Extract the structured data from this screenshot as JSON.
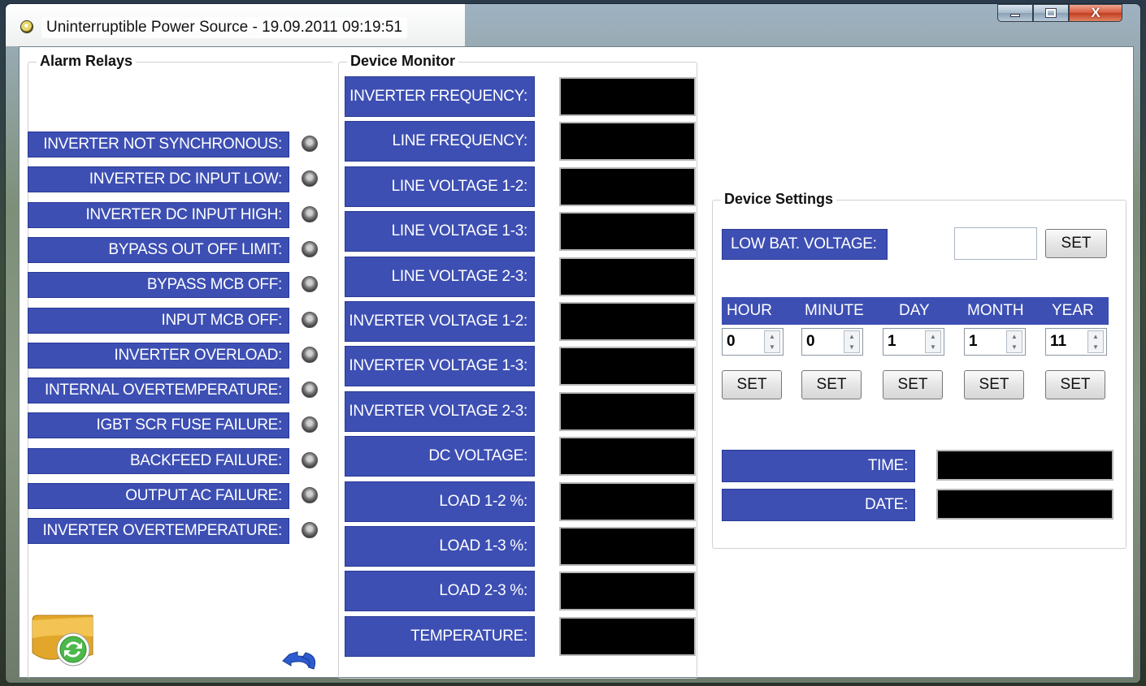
{
  "window": {
    "title": "Uninterruptible Power Source - 19.09.2011 09:19:51",
    "close_glyph": "X"
  },
  "alarm_relays": {
    "title": "Alarm Relays",
    "items": [
      "INVERTER NOT SYNCHRONOUS:",
      "INVERTER DC INPUT LOW:",
      "INVERTER DC INPUT HIGH:",
      "BYPASS OUT OFF LIMIT:",
      "BYPASS MCB OFF:",
      "INPUT MCB OFF:",
      "INVERTER OVERLOAD:",
      "INTERNAL OVERTEMPERATURE:",
      "IGBT SCR FUSE FAILURE:",
      "BACKFEED FAILURE:",
      "OUTPUT AC FAILURE:",
      "INVERTER OVERTEMPERATURE:"
    ]
  },
  "device_monitor": {
    "title": "Device Monitor",
    "items": [
      "INVERTER FREQUENCY:",
      "LINE FREQUENCY:",
      "LINE VOLTAGE 1-2:",
      "LINE VOLTAGE 1-3:",
      "LINE VOLTAGE 2-3:",
      "INVERTER VOLTAGE 1-2:",
      "INVERTER VOLTAGE 1-3:",
      "INVERTER VOLTAGE 2-3:",
      "DC VOLTAGE:",
      "LOAD 1-2 %:",
      "LOAD 1-3 %:",
      "LOAD 2-3 %:",
      "TEMPERATURE:"
    ]
  },
  "device_settings": {
    "title": "Device Settings",
    "low_bat_label": "LOW BAT. VOLTAGE:",
    "low_bat_value": "",
    "set_label": "SET",
    "datetime_headers": [
      "HOUR",
      "MINUTE",
      "DAY",
      "MONTH",
      "YEAR"
    ],
    "datetime_values": [
      "0",
      "0",
      "1",
      "1",
      "11"
    ],
    "time_label": "TIME:",
    "date_label": "DATE:"
  },
  "icons": {
    "refresh": "refresh-icon",
    "undo": "undo-icon",
    "spin_up": "▲",
    "spin_down": "▼"
  },
  "colors": {
    "label_blue": "#3d4fb3",
    "display_black": "#000000"
  }
}
